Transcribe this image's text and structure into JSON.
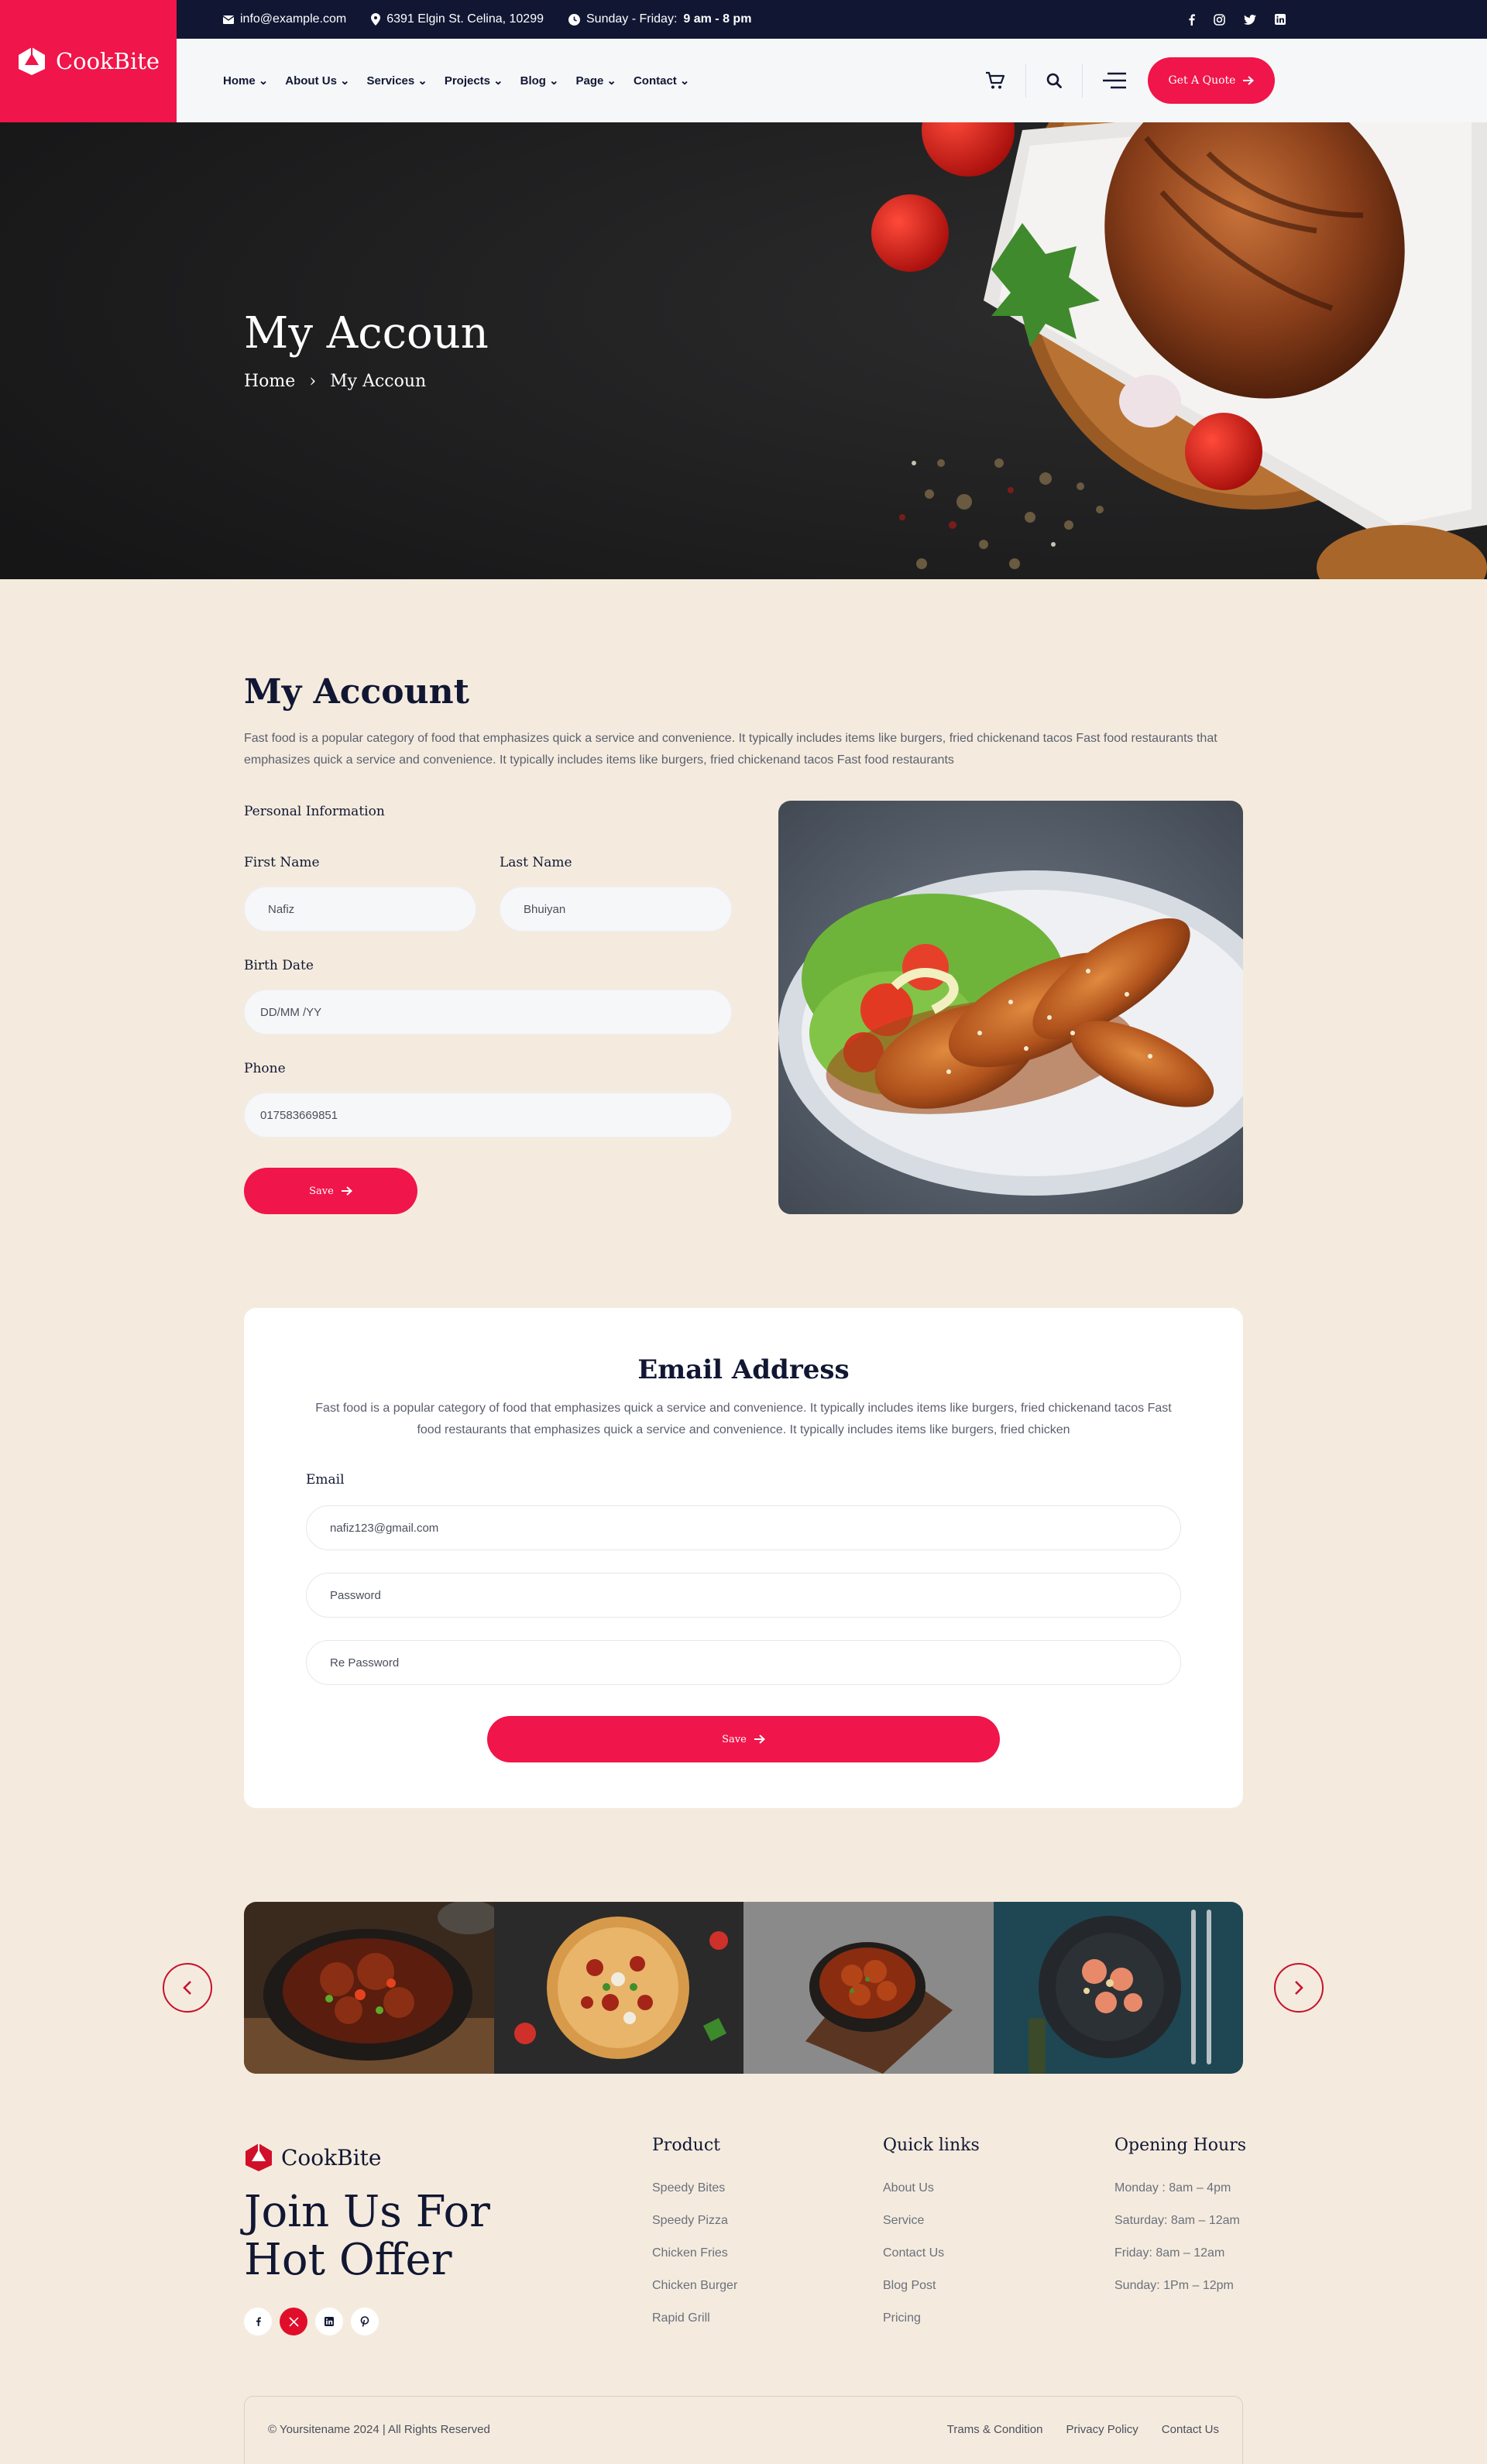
{
  "brand": {
    "name": "CookBite",
    "accent": "#f0154a",
    "dark": "#111733"
  },
  "topbar": {
    "email": "info@example.com",
    "address": "6391 Elgin St. Celina, 10299",
    "hours_label": "Sunday - Friday:",
    "hours_value": "9 am - 8 pm",
    "socials": [
      "facebook-icon",
      "instagram-icon",
      "twitter-icon",
      "linkedin-icon"
    ]
  },
  "nav": {
    "items": [
      {
        "label": "Home"
      },
      {
        "label": "About Us"
      },
      {
        "label": "Services"
      },
      {
        "label": "Projects"
      },
      {
        "label": "Blog"
      },
      {
        "label": "Page"
      },
      {
        "label": "Contact"
      }
    ],
    "cta": "Get A Quote"
  },
  "hero": {
    "title": "My Accoun",
    "breadcrumb": {
      "home": "Home",
      "current": "My Accoun"
    }
  },
  "account": {
    "title": "My Account",
    "description": "Fast food is a popular category of food that emphasizes quick a service and convenience. It typically includes items like burgers, fried chickenand tacos Fast food restaurants that emphasizes quick a service and convenience. It typically includes items like burgers, fried chickenand tacos Fast food restaurants",
    "section_label": "Personal Information",
    "first_name": {
      "label": "First Name",
      "value": "Nafiz"
    },
    "last_name": {
      "label": "Last Name",
      "value": "Bhuiyan"
    },
    "birth_date": {
      "label": "Birth Date",
      "value": "DD/MM /YY"
    },
    "phone": {
      "label": "Phone",
      "value": "017583669851"
    },
    "save": "Save"
  },
  "email_section": {
    "title": "Email Address",
    "description": "Fast food is a popular category of food that emphasizes quick a service and convenience. It typically includes items like burgers, fried chickenand tacos Fast food restaurants  that emphasizes quick a service and convenience. It typically includes items like burgers, fried chicken",
    "email_label": "Email",
    "email_value": "nafiz123@gmail.com",
    "password_placeholder": "Password",
    "repassword_placeholder": "Re Password",
    "save": "Save"
  },
  "footer": {
    "logo": "CookBite",
    "headline": "Join Us For Hot Offer",
    "socials": [
      "facebook-icon",
      "x-icon",
      "linkedin-icon",
      "pinterest-icon"
    ],
    "product": {
      "title": "Product",
      "items": [
        "Speedy Bites",
        "Speedy Pizza",
        "Chicken Fries",
        "Chicken Burger",
        "Rapid Grill"
      ]
    },
    "quick_links": {
      "title": "Quick links",
      "items": [
        "About Us",
        "Service",
        "Contact Us",
        "Blog Post",
        "Pricing"
      ]
    },
    "hours": {
      "title": "Opening Hours",
      "items": [
        "Monday : 8am – 4pm",
        "Saturday: 8am – 12am",
        "Friday: 8am – 12am",
        "Sunday: 1Pm – 12pm"
      ]
    },
    "copyright": "© Yoursitename  2024 | All Rights Reserved",
    "bottom_links": [
      "Trams & Condition",
      "Privacy Policy",
      "Contact Us"
    ]
  }
}
